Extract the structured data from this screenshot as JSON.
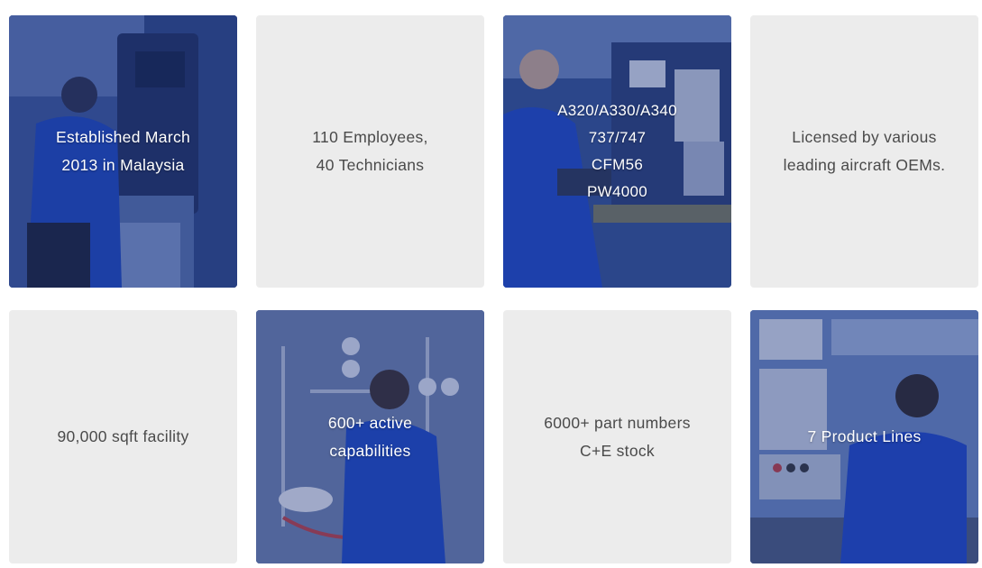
{
  "tiles": [
    {
      "text": "Established March\n2013 in Malaysia",
      "kind": "photo",
      "image": "technician-at-machine-photo"
    },
    {
      "text": "110 Employees,\n40 Technicians",
      "kind": "plain"
    },
    {
      "text": "A320/A330/A340\n737/747\nCFM56\nPW4000",
      "kind": "photo",
      "image": "technician-at-test-bench-photo"
    },
    {
      "text": "Licensed by various\nleading aircraft OEMs.",
      "kind": "plain"
    },
    {
      "text": "90,000 sqft facility",
      "kind": "plain"
    },
    {
      "text": "600+ active\ncapabilities",
      "kind": "photo",
      "image": "technician-at-valve-panel-photo"
    },
    {
      "text": "6000+ part numbers\nC+E stock",
      "kind": "plain"
    },
    {
      "text": "7 Product Lines",
      "kind": "photo",
      "image": "technician-at-control-console-photo"
    }
  ],
  "colors": {
    "plain_tile": "#ececec",
    "plain_text": "#4a4a4a",
    "photo_overlay": "#1c3482",
    "photo_text": "#ffffff"
  }
}
